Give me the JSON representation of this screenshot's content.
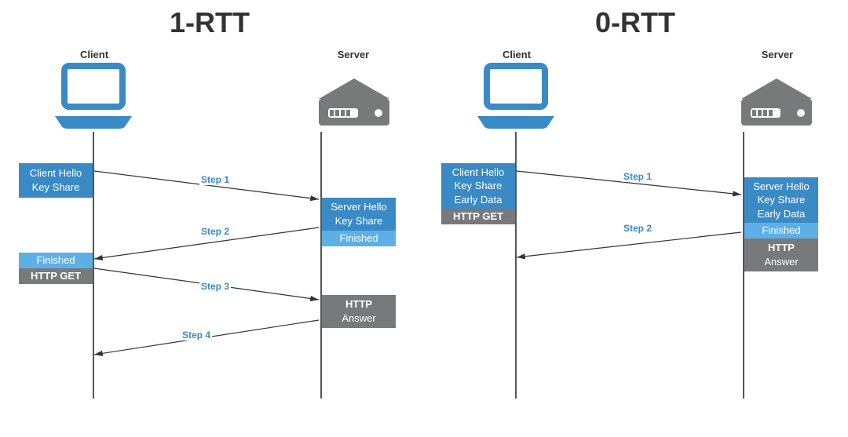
{
  "titles": {
    "left": "1-RTT",
    "right": "0-RTT"
  },
  "roles": {
    "client": "Client",
    "server": "Server"
  },
  "steps": {
    "s1": "Step 1",
    "s2": "Step 2",
    "s3": "Step 3",
    "s4": "Step 4"
  },
  "left": {
    "client_hello_l1": "Client Hello",
    "client_hello_l2": "Key Share",
    "server_hello_l1": "Server Hello",
    "server_hello_l2": "Key Share",
    "server_finished": "Finished",
    "client_finished": "Finished",
    "http_get": "HTTP GET",
    "http_answer_l1": "HTTP",
    "http_answer_l2": "Answer"
  },
  "right": {
    "client_hello_l1": "Client Hello",
    "client_hello_l2": "Key Share",
    "client_hello_l3": "Early Data",
    "http_get": "HTTP GET",
    "server_hello_l1": "Server Hello",
    "server_hello_l2": "Key Share",
    "server_hello_l3": "Early Data",
    "server_finished": "Finished",
    "http_answer_l1": "HTTP",
    "http_answer_l2": "Answer"
  },
  "chart_data": {
    "type": "sequence-diagram",
    "diagrams": [
      {
        "title": "1-RTT",
        "participants": [
          "Client",
          "Server"
        ],
        "messages": [
          {
            "step": 1,
            "from": "Client",
            "to": "Server",
            "content": [
              "Client Hello",
              "Key Share"
            ]
          },
          {
            "step": 2,
            "from": "Server",
            "to": "Client",
            "content": [
              "Server Hello",
              "Key Share",
              "Finished"
            ]
          },
          {
            "step": 3,
            "from": "Client",
            "to": "Server",
            "content": [
              "Finished",
              "HTTP GET"
            ]
          },
          {
            "step": 4,
            "from": "Server",
            "to": "Client",
            "content": [
              "HTTP Answer"
            ]
          }
        ]
      },
      {
        "title": "0-RTT",
        "participants": [
          "Client",
          "Server"
        ],
        "messages": [
          {
            "step": 1,
            "from": "Client",
            "to": "Server",
            "content": [
              "Client Hello",
              "Key Share",
              "Early Data",
              "HTTP GET"
            ]
          },
          {
            "step": 2,
            "from": "Server",
            "to": "Client",
            "content": [
              "Server Hello",
              "Key Share",
              "Early Data",
              "Finished",
              "HTTP Answer"
            ]
          }
        ]
      }
    ]
  }
}
